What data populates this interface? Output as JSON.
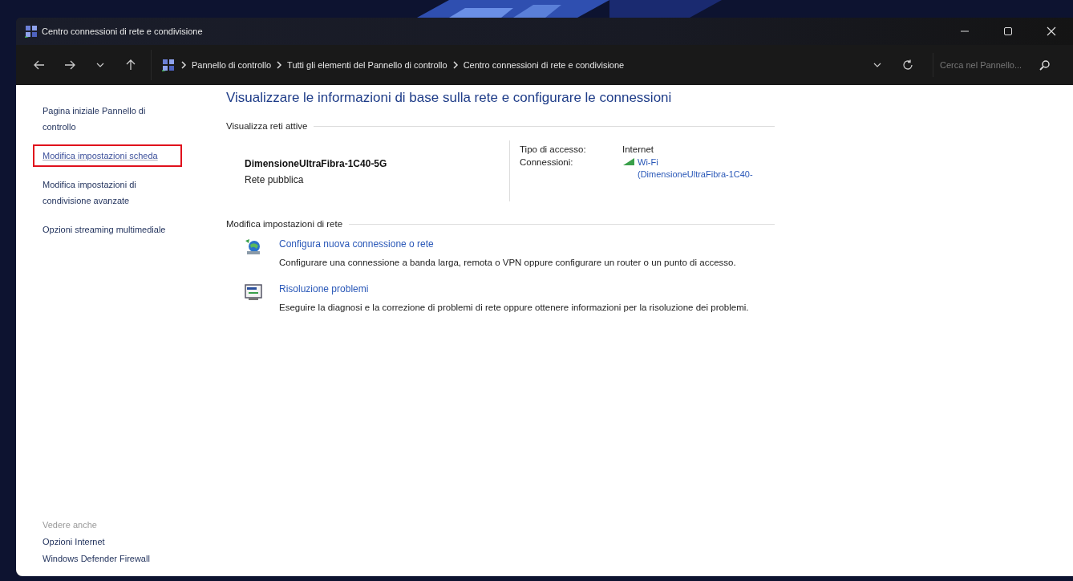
{
  "window": {
    "title": "Centro connessioni di rete e condivisione"
  },
  "address_bar": {
    "breadcrumbs": [
      "Pannello di controllo",
      "Tutti gli elementi del Pannello di controllo",
      "Centro connessioni di rete e condivisione"
    ]
  },
  "search": {
    "placeholder": "Cerca nel Pannello..."
  },
  "sidebar": {
    "links": [
      {
        "label": "Pagina iniziale Pannello di controllo",
        "highlighted": false
      },
      {
        "label": "Modifica impostazioni scheda",
        "highlighted": true
      },
      {
        "label": "Modifica impostazioni di condivisione avanzate",
        "highlighted": false
      },
      {
        "label": "Opzioni streaming multimediale",
        "highlighted": false
      }
    ],
    "see_also": {
      "title": "Vedere anche",
      "links": [
        "Opzioni Internet",
        "Windows Defender Firewall"
      ]
    }
  },
  "main": {
    "heading": "Visualizzare le informazioni di base sulla rete e configurare le connessioni",
    "active_networks": {
      "title": "Visualizza reti attive",
      "networks": [
        {
          "name": "DimensioneUltraFibra-1C40-5G",
          "category": "Rete pubblica",
          "access_type_label": "Tipo di accesso:",
          "access_type": "Internet",
          "connections_label": "Connessioni:",
          "connection": "Wi-Fi",
          "connection_detail": "(DimensioneUltraFibra-1C40-"
        }
      ]
    },
    "settings": {
      "title": "Modifica impostazioni di rete",
      "tasks": [
        {
          "kind": "new-connection",
          "link": "Configura nuova connessione o rete",
          "description": "Configurare una connessione a banda larga, remota o VPN oppure configurare un router o un punto di accesso."
        },
        {
          "kind": "troubleshoot",
          "link": "Risoluzione problemi",
          "description": "Eseguire la diagnosi e la correzione di problemi di rete oppure ottenere informazioni per la risoluzione dei problemi."
        }
      ]
    }
  }
}
